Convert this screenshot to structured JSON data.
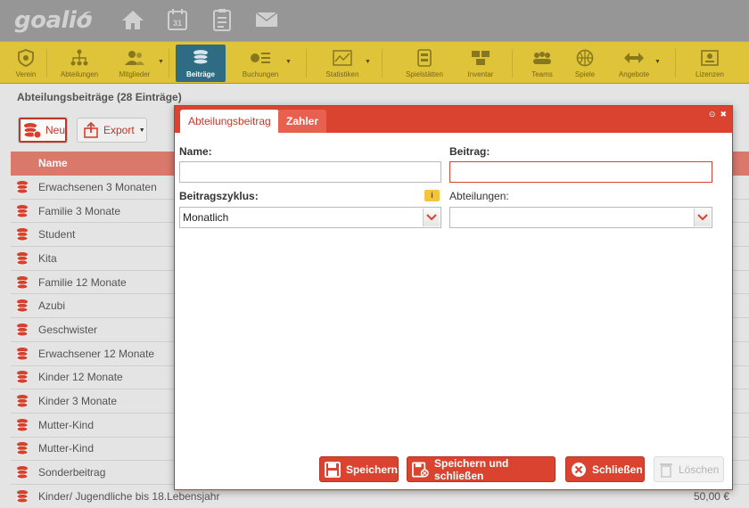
{
  "app": {
    "logo": "goalio"
  },
  "top_icons": [
    "home-icon",
    "calendar-icon",
    "clipboard-icon",
    "mail-icon"
  ],
  "calendar_day": "31",
  "toolbar": {
    "items": [
      {
        "label": "Verein",
        "icon": "shield-icon"
      },
      {
        "label": "Abteilungen",
        "icon": "org-chart-icon"
      },
      {
        "label": "Mitglieder",
        "icon": "members-icon"
      },
      {
        "label": "Beiträge",
        "icon": "coins-icon"
      },
      {
        "label": "Buchungen",
        "icon": "bookings-icon"
      },
      {
        "label": "Statistiken",
        "icon": "stats-icon"
      },
      {
        "label": "Spielstätten",
        "icon": "venue-icon"
      },
      {
        "label": "Inventar",
        "icon": "inventory-icon"
      },
      {
        "label": "Teams",
        "icon": "teams-icon"
      },
      {
        "label": "Spiele",
        "icon": "ball-icon"
      },
      {
        "label": "Angebote",
        "icon": "offers-icon"
      },
      {
        "label": "Lizenzen",
        "icon": "license-icon"
      }
    ]
  },
  "page": {
    "title": "Abteilungsbeiträge (28 Einträge)",
    "new_label": "Neu",
    "export_label": "Export"
  },
  "table": {
    "header": "Name",
    "rows": [
      {
        "name": "Erwachsenen 3 Monaten",
        "price": ""
      },
      {
        "name": "Familie 3 Monate",
        "price": ""
      },
      {
        "name": "Student",
        "price": ""
      },
      {
        "name": "Kita",
        "price": ""
      },
      {
        "name": "Familie 12 Monate",
        "price": ""
      },
      {
        "name": "Azubi",
        "price": ""
      },
      {
        "name": "Geschwister",
        "price": ""
      },
      {
        "name": "Erwachsener 12 Monate",
        "price": ""
      },
      {
        "name": "Kinder 12 Monate",
        "price": ""
      },
      {
        "name": "Kinder 3 Monate",
        "price": ""
      },
      {
        "name": "Mutter-Kind",
        "price": ""
      },
      {
        "name": "Mutter-Kind",
        "price": ""
      },
      {
        "name": "Sonderbeitrag",
        "price": ""
      },
      {
        "name": "Kinder/ Jugendliche bis 18.Lebensjahr",
        "price": "50,00 €"
      }
    ]
  },
  "modal": {
    "tabs": [
      "Abteilungsbeitrag",
      "Zahler"
    ],
    "name_label": "Name:",
    "name_value": "",
    "beitrag_label": "Beitrag:",
    "beitrag_value": "",
    "zyklus_label": "Beitragszyklus:",
    "zyklus_value": "Monatlich",
    "info_badge": "i",
    "abteilungen_label": "Abteilungen:",
    "abteilungen_value": "",
    "buttons": {
      "save": "Speichern",
      "save_close": "Speichern und schließen",
      "close": "Schließen",
      "delete": "Löschen"
    }
  },
  "colors": {
    "accent": "#d9432f",
    "toolbar": "#e4c73a",
    "active_tab": "#2f6f86",
    "table_header": "#e07b6f"
  }
}
